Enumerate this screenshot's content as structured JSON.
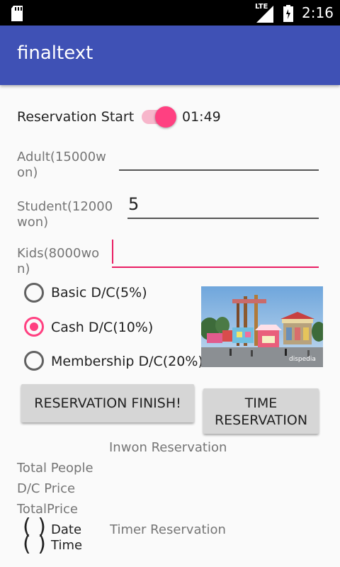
{
  "status_bar": {
    "network": "LTE",
    "time": "2:16"
  },
  "app_bar": {
    "title": "finaltext"
  },
  "reservation": {
    "start_label": "Reservation Start",
    "switch_on": true,
    "timer": "01:49"
  },
  "inputs": {
    "adult_label_line1": "Adult(15000w",
    "adult_label_line2": "on)",
    "adult_value": "",
    "student_label_line1": "Student(12000",
    "student_label_line2": "won)",
    "student_value": "5",
    "kids_label_line1": "Kids(8000wo",
    "kids_label_line2": "n)",
    "kids_value": ""
  },
  "discounts": {
    "options": [
      "Basic D/C(5%)",
      "Cash D/C(10%)",
      "Membership D/C(20%)"
    ],
    "selected": "Cash D/C(10%)"
  },
  "image": {
    "watermark": "dispedia"
  },
  "buttons": {
    "finish": "RESERVATION FINISH!",
    "time_line1": "TIME",
    "time_line2": "RESERVATION"
  },
  "summary": {
    "inwon_title": "Inwon Reservation",
    "total_people": "Total People",
    "dc_price": "D/C Price",
    "total_price": "TotalPrice",
    "date_label": "Date",
    "time_label": "Time",
    "timer_title": "Timer Reservation"
  },
  "colors": {
    "primary": "#3f51b5",
    "accent": "#ff4081",
    "background": "#fafafa"
  }
}
